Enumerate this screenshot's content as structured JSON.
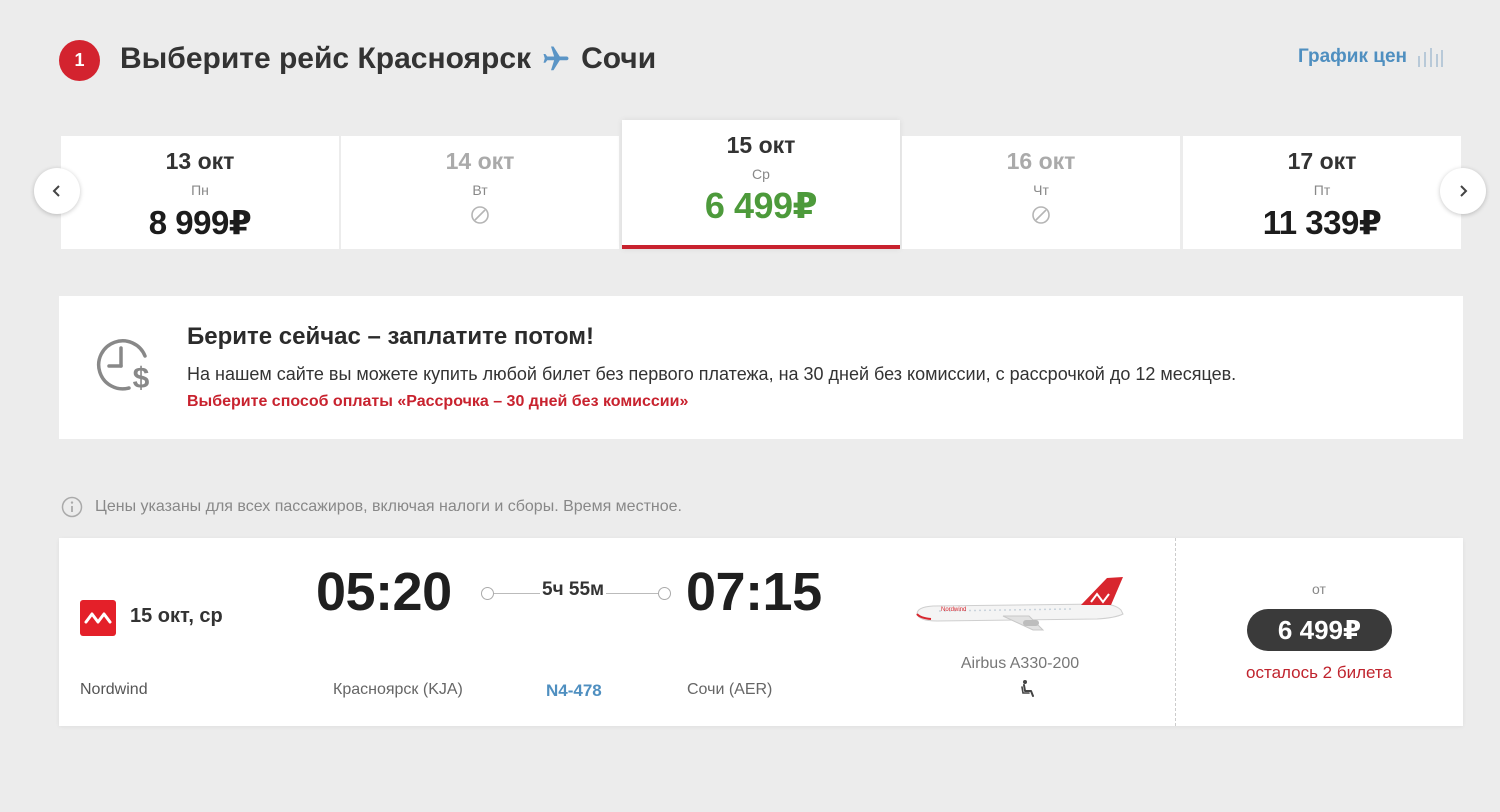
{
  "header": {
    "step": "1",
    "title_prefix": "Выберите рейс",
    "origin": "Красноярск",
    "destination": "Сочи",
    "price_chart_label": "График цен"
  },
  "dates": [
    {
      "date": "13 окт",
      "dow": "Пн",
      "price": "8 999₽",
      "available": true
    },
    {
      "date": "14 окт",
      "dow": "Вт",
      "price": "",
      "available": false
    },
    {
      "date": "15 окт",
      "dow": "Ср",
      "price": "6 499₽",
      "available": true,
      "selected": true
    },
    {
      "date": "16 окт",
      "dow": "Чт",
      "price": "",
      "available": false
    },
    {
      "date": "17 окт",
      "dow": "Пт",
      "price": "11 339₽",
      "available": true
    }
  ],
  "promo": {
    "title": "Берите сейчас – заплатите потом!",
    "text": "На нашем сайте вы можете купить любой билет без первого платежа, на 30 дней без комиссии, с рассрочкой до 12 месяцев.",
    "link": "Выберите способ оплаты «Рассрочка – 30 дней без комиссии»"
  },
  "note": "Цены указаны для всех пассажиров, включая налоги и сборы. Время местное.",
  "flight": {
    "date": "15 окт, ср",
    "airline": "Nordwind",
    "departure_time": "05:20",
    "arrival_time": "07:15",
    "duration": "5ч 55м",
    "departure_city": "Красноярск (KJA)",
    "arrival_city": "Сочи (AER)",
    "flight_number": "N4-478",
    "aircraft": "Airbus A330-200",
    "price_prefix": "от",
    "price": "6 499₽",
    "seats_left": "осталось 2 билета"
  },
  "colors": {
    "accent_red": "#c8222e",
    "price_green": "#4d9a3b",
    "link_blue": "#4f8fc0",
    "airline_red": "#e42029"
  }
}
